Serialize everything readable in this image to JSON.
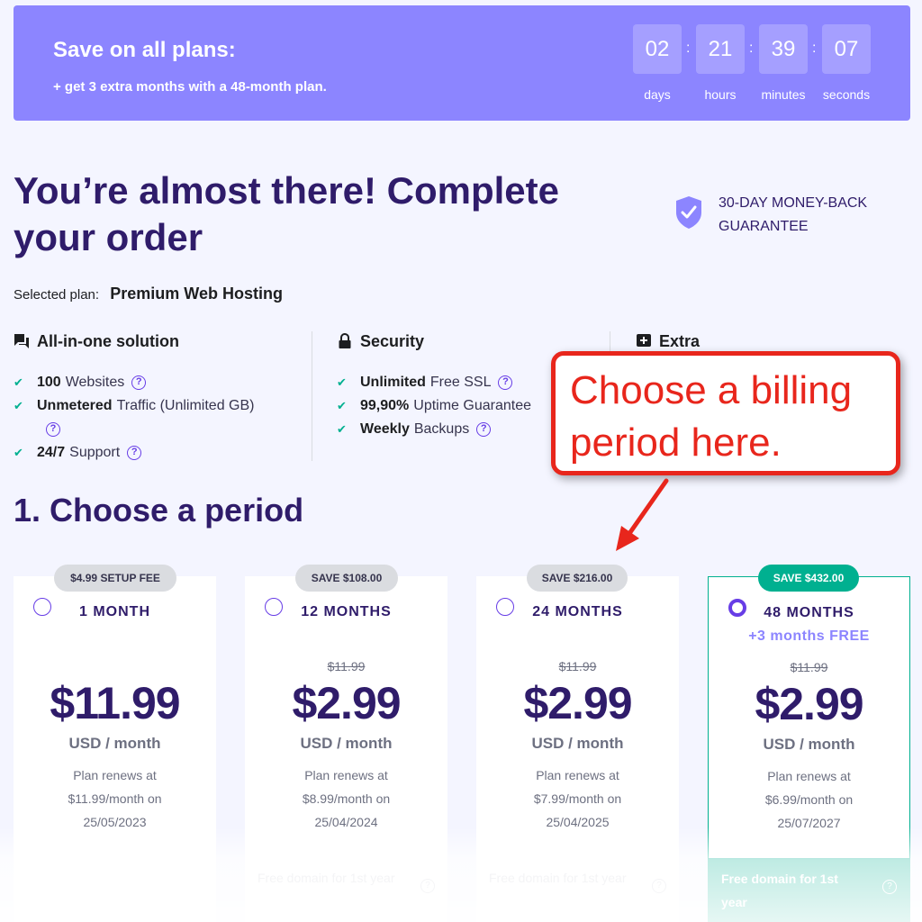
{
  "banner": {
    "title": "Save on all plans:",
    "subtitle": "+ get 3 extra months with a 48-month plan.",
    "timer": [
      {
        "value": "02",
        "label": "days"
      },
      {
        "value": "21",
        "label": "hours"
      },
      {
        "value": "39",
        "label": "minutes"
      },
      {
        "value": "07",
        "label": "seconds"
      }
    ],
    "separator": ":"
  },
  "header": {
    "title": "You’re almost there! Complete your order",
    "guarantee_line1": "30-DAY MONEY-BACK",
    "guarantee_line2": "GUARANTEE"
  },
  "selected_plan": {
    "label": "Selected plan:",
    "value": "Premium Web Hosting"
  },
  "features": [
    {
      "heading": "All-in-one solution",
      "icon": "chat-icon",
      "items": [
        {
          "bold": "100",
          "text": "Websites",
          "help": true
        },
        {
          "bold": "Unmetered",
          "text": "Traffic (Unlimited GB)",
          "help": true
        },
        {
          "bold": "24/7",
          "text": "Support",
          "help": true
        }
      ]
    },
    {
      "heading": "Security",
      "icon": "lock-icon",
      "items": [
        {
          "bold": "Unlimited",
          "text": "Free SSL",
          "help": true
        },
        {
          "bold": "99,90%",
          "text": "Uptime Guarantee",
          "help": true
        },
        {
          "bold": "Weekly",
          "text": "Backups",
          "help": true
        }
      ]
    },
    {
      "heading": "Extra",
      "icon": "plus-box-icon",
      "items": []
    }
  ],
  "callout": {
    "line1": "Choose a billing",
    "line2": "period here."
  },
  "section": {
    "title": "1. Choose a period"
  },
  "plans": [
    {
      "badge": "$4.99 SETUP FEE",
      "period": "1 MONTH",
      "bonus": "",
      "old_price": "",
      "price": "$11.99",
      "unit": "USD / month",
      "renew1": "Plan renews at",
      "renew2": "$11.99/month on",
      "renew3": "25/05/2023",
      "free_domain": "",
      "selected": false
    },
    {
      "badge": "SAVE $108.00",
      "period": "12 MONTHS",
      "bonus": "",
      "old_price": "$11.99",
      "price": "$2.99",
      "unit": "USD / month",
      "renew1": "Plan renews at",
      "renew2": "$8.99/month on",
      "renew3": "25/04/2024",
      "free_domain": "Free domain for 1st year",
      "selected": false
    },
    {
      "badge": "SAVE $216.00",
      "period": "24 MONTHS",
      "bonus": "",
      "old_price": "$11.99",
      "price": "$2.99",
      "unit": "USD / month",
      "renew1": "Plan renews at",
      "renew2": "$7.99/month on",
      "renew3": "25/04/2025",
      "free_domain": "Free domain for 1st year",
      "selected": false
    },
    {
      "badge": "SAVE $432.00",
      "period": "48 MONTHS",
      "bonus": "+3 months FREE",
      "old_price": "$11.99",
      "price": "$2.99",
      "unit": "USD / month",
      "renew1": "Plan renews at",
      "renew2": "$6.99/month on",
      "renew3": "25/07/2027",
      "free_domain": "Free domain for 1st year",
      "selected": true
    }
  ],
  "colors": {
    "banner": "#8c85ff",
    "primary_text": "#2f1c6a",
    "accent": "#673de6",
    "success": "#00b090",
    "callout_red": "#e8261c"
  }
}
